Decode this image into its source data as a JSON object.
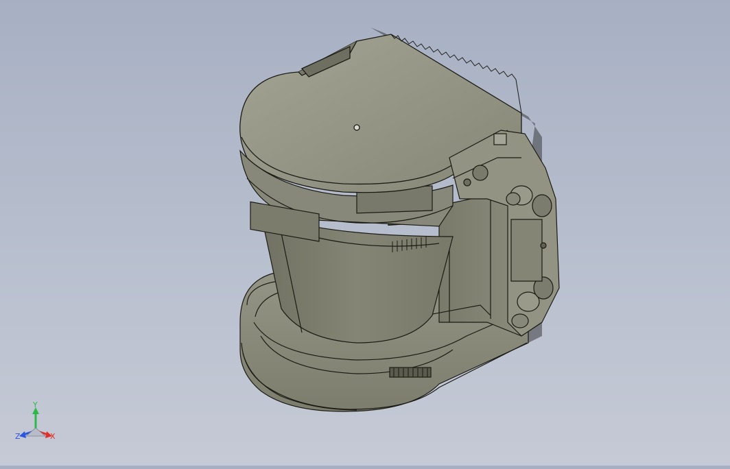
{
  "window": {
    "title": ""
  },
  "model": {
    "body_color": "#8c8c7b",
    "body_light": "#a6a696",
    "body_dark": "#6b6b5c",
    "edge_color": "#1a1a14",
    "shadow_color": "#3c3c3c"
  },
  "triad": {
    "labels": {
      "y": "Y",
      "z": "Z",
      "x": "X"
    },
    "colors": {
      "x": "#e0302a",
      "y": "#2fb84a",
      "z": "#2a55e0"
    }
  },
  "background": {
    "top": "#a7b0c3",
    "bottom": "#c6cad6"
  }
}
